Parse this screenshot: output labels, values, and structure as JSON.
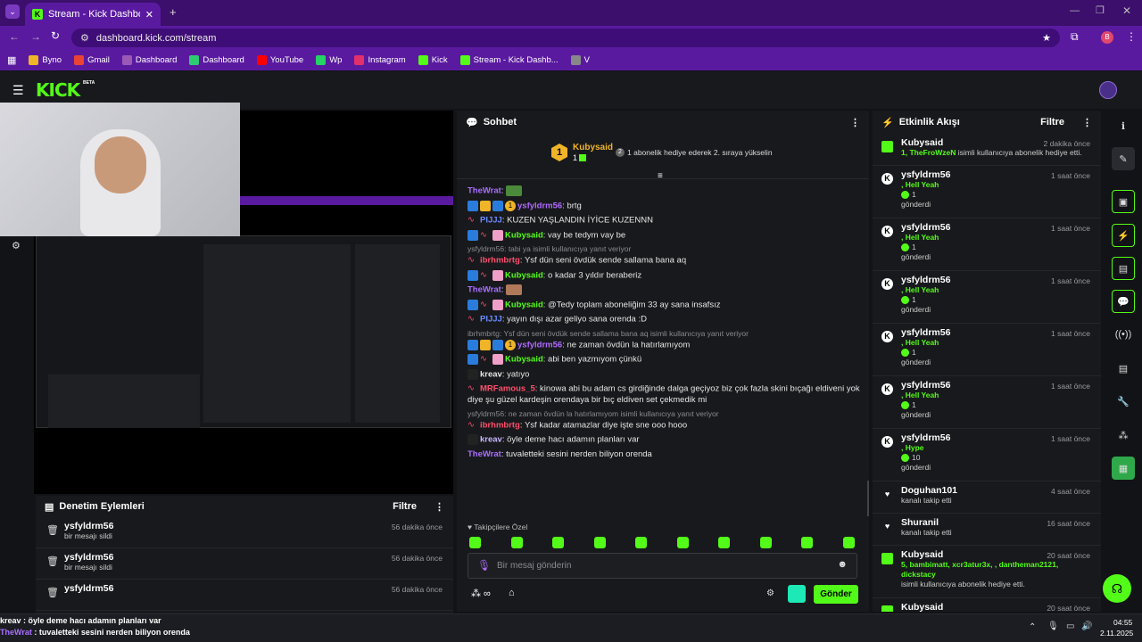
{
  "browser": {
    "tab_title": "Stream - Kick Dashboard",
    "url": "dashboard.kick.com/stream",
    "profile_initial": "B"
  },
  "bookmarks": [
    {
      "label": "Byno",
      "color": "#f0b429"
    },
    {
      "label": "Gmail",
      "color": "#ea4335"
    },
    {
      "label": "Dashboard",
      "color": "#9b59b6"
    },
    {
      "label": "Dashboard",
      "color": "#2ecc71"
    },
    {
      "label": "YouTube",
      "color": "#ff0000"
    },
    {
      "label": "Wp",
      "color": "#25d366"
    },
    {
      "label": "Instagram",
      "color": "#e1306c"
    },
    {
      "label": "Kick",
      "color": "#53fc18"
    },
    {
      "label": "Stream - Kick Dashb...",
      "color": "#53fc18"
    },
    {
      "label": "V",
      "color": "#888888"
    }
  ],
  "kick": {
    "logo": "KICK",
    "beta": "BETA"
  },
  "moderation": {
    "title": "Denetim Eylemleri",
    "filter": "Filtre",
    "rows": [
      {
        "user": "ysfyldrm56",
        "action": "bir mesajı sildi",
        "time": "56 dakika önce"
      },
      {
        "user": "ysfyldrm56",
        "action": "bir mesajı sildi",
        "time": "56 dakika önce"
      },
      {
        "user": "ysfyldrm56",
        "action": "",
        "time": "56 dakika önce"
      }
    ]
  },
  "chat": {
    "title": "Sohbet",
    "top_gifter": {
      "name": "Kubysaid",
      "count": "1",
      "rank": "1"
    },
    "gift_hint": "1 abonelik hediye ederek 2. sıraya yükselin",
    "rank_two": "2",
    "messages": [
      {
        "reply": "",
        "user": "TheWrat",
        "color": "#a970ff",
        "text": "",
        "badges": [],
        "emote": "pepe"
      },
      {
        "reply": "",
        "user": "ysfyldrm56",
        "color": "#b06bff",
        "text": "brtg",
        "badges": [
          "#2a7cdc",
          "#f0b429",
          "#2a7cdc"
        ],
        "gold": "1"
      },
      {
        "reply": "",
        "user": "PIJJJ",
        "color": "#6b8cff",
        "text": "KUZEN YAŞLANDIN İYİCE KUZENNN",
        "badges": [
          "wave"
        ]
      },
      {
        "reply": "",
        "user": "Kubysaid",
        "color": "#53fc18",
        "text": "vay be tedym vay be",
        "badges": [
          "#2a7cdc",
          "wave",
          "gift"
        ]
      },
      {
        "reply": "ysfyldrm56: tabi ya isimli kullanıcıya yanıt veriyor",
        "user": "ibrhmbrtg",
        "color": "#ff4d6d",
        "text": "Ysf dün seni övdük sende sallama bana aq",
        "badges": [
          "wave"
        ]
      },
      {
        "reply": "",
        "user": "Kubysaid",
        "color": "#53fc18",
        "text": "o kadar 3 yıldır beraberiz",
        "badges": [
          "#2a7cdc",
          "wave",
          "gift"
        ]
      },
      {
        "reply": "",
        "user": "TheWrat",
        "color": "#a970ff",
        "text": "",
        "badges": [],
        "emote": "face"
      },
      {
        "reply": "",
        "user": "Kubysaid",
        "color": "#53fc18",
        "text": "@Tedy toplam aboneliğim 33 ay sana insafsız",
        "badges": [
          "#2a7cdc",
          "wave",
          "gift"
        ]
      },
      {
        "reply": "",
        "user": "PIJJJ",
        "color": "#6b8cff",
        "text": "yayın dışı azar geliyo sana orenda :D",
        "badges": [
          "wave"
        ]
      },
      {
        "reply": "ibrhmbrtg: Ysf dün seni övdük sende sallama bana aq isimli kullanıcıya yanıt veriyor",
        "user": "ysfyldrm56",
        "color": "#b06bff",
        "text": "ne zaman övdün la hatırlamıyom",
        "badges": [
          "#2a7cdc",
          "#f0b429",
          "#2a7cdc"
        ],
        "gold": "1"
      },
      {
        "reply": "",
        "user": "Kubysaid",
        "color": "#53fc18",
        "text": "abi ben yazmıyom çünkü",
        "badges": [
          "#2a7cdc",
          "wave",
          "gift"
        ]
      },
      {
        "reply": "",
        "user": "kreav",
        "color": "#e6e6e6",
        "text": "yatıyo",
        "badges": [
          "dark"
        ]
      },
      {
        "reply": "",
        "user": "MRFamous_5",
        "color": "#ff4d6d",
        "text": "kinowa abi bu adam cs girdiğinde dalga geçiyoz biz çok fazla skini bıçağı eldiveni yok diye şu güzel kardeşin orendaya bir bıç eldiven set çekmedik mi",
        "badges": [
          "wave"
        ]
      },
      {
        "reply": "ysfyldrm56: ne zaman övdün la hatırlamıyom isimli kullanıcıya yanıt veriyor",
        "user": "ibrhmbrtg",
        "color": "#ff4d6d",
        "text": "Ysf kadar atamazlar diye işte sne ooo hooo",
        "badges": [
          "wave"
        ]
      },
      {
        "reply": "",
        "user": "kreav",
        "color": "#c9b8ff",
        "text": "öyle deme hacı adamın planları var",
        "badges": [
          "dark"
        ]
      },
      {
        "reply": "",
        "user": "TheWrat",
        "color": "#a970ff",
        "text": "tuvaletteki sesini nerden biliyon orenda",
        "badges": []
      }
    ],
    "followers_only": "Takipçilere Özel",
    "input_placeholder": "Bir mesaj gönderin",
    "send": "Gönder"
  },
  "activity": {
    "title": "Etkinlik Akışı",
    "filter": "Filtre",
    "events": [
      {
        "icon": "gift",
        "name": "Kubysaid",
        "time": "2 dakika önce",
        "line1": "1, TheFroWzeN",
        "line1_rest": " isimli kullanıcıya abonelik hediye etti.",
        "line2": ""
      },
      {
        "icon": "kick",
        "name": "ysfyldrm56",
        "time": "1 saat önce",
        "line1": ", Hell Yeah",
        "line1_rest": "",
        "amount": "1",
        "line2": "gönderdi"
      },
      {
        "icon": "kick",
        "name": "ysfyldrm56",
        "time": "1 saat önce",
        "line1": ", Hell Yeah",
        "line1_rest": "",
        "amount": "1",
        "line2": "gönderdi"
      },
      {
        "icon": "kick",
        "name": "ysfyldrm56",
        "time": "1 saat önce",
        "line1": ", Hell Yeah",
        "line1_rest": "",
        "amount": "1",
        "line2": "gönderdi"
      },
      {
        "icon": "kick",
        "name": "ysfyldrm56",
        "time": "1 saat önce",
        "line1": ", Hell Yeah",
        "line1_rest": "",
        "amount": "1",
        "line2": "gönderdi"
      },
      {
        "icon": "kick",
        "name": "ysfyldrm56",
        "time": "1 saat önce",
        "line1": ", Hell Yeah",
        "line1_rest": "",
        "amount": "1",
        "line2": "gönderdi"
      },
      {
        "icon": "kick",
        "name": "ysfyldrm56",
        "time": "1 saat önce",
        "line1": ", Hype",
        "line1_rest": "",
        "amount": "10",
        "line2": "gönderdi"
      },
      {
        "icon": "heart",
        "name": "Doguhan101",
        "time": "4 saat önce",
        "line1": "",
        "line1_rest": "kanalı takip etti",
        "line2": ""
      },
      {
        "icon": "heart",
        "name": "Shuranil",
        "time": "16 saat önce",
        "line1": "",
        "line1_rest": "kanalı takip etti",
        "line2": ""
      },
      {
        "icon": "gift",
        "name": "Kubysaid",
        "time": "20 saat önce",
        "line1": "5, bambimatt, xcr3atur3x, , dantheman2121, dickstacy",
        "line1_rest": "",
        "line2": "isimli kullanıcıya abonelik hediye etti."
      },
      {
        "icon": "gift",
        "name": "Kubysaid",
        "time": "20 saat önce",
        "line1": "",
        "line1_rest": "",
        "line2": ""
      }
    ]
  },
  "overlay": {
    "line1_user": "kreav",
    "line1_text": " : öyle deme hacı adamın planları var",
    "line2_user": "TheWrat",
    "line2_text": " : tuvaletteki sesini nerden biliyon orenda"
  },
  "taskbar": {
    "time": "04:55",
    "date": "2.11.2025"
  },
  "colors": {
    "accent": "#53fc18",
    "chrome": "#5a1aa0"
  }
}
